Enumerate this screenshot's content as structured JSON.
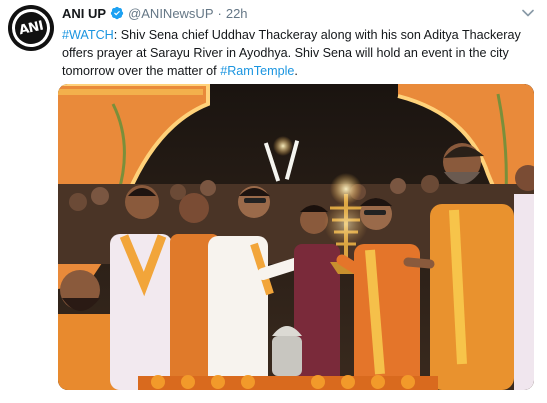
{
  "tweet": {
    "author_name": "ANI UP",
    "handle": "@ANINewsUP",
    "separator": "·",
    "time": "22h",
    "avatar_text": "ANI",
    "text_hashtag_1": "#WATCH",
    "text_part_1": ": Shiv Sena chief Uddhav Thackeray along with his son Aditya Thackeray offers prayer at Sarayu River in Ayodhya. Shiv Sena will hold an event in the city tomorrow over the matter of ",
    "text_hashtag_2": "#RamTemple",
    "text_part_2": "."
  },
  "colors": {
    "link": "#1b95e0",
    "verified": "#1da1f2",
    "secondary_text": "#657786"
  },
  "icons": {
    "verified": "verified-badge-icon",
    "caret": "chevron-down-icon"
  }
}
